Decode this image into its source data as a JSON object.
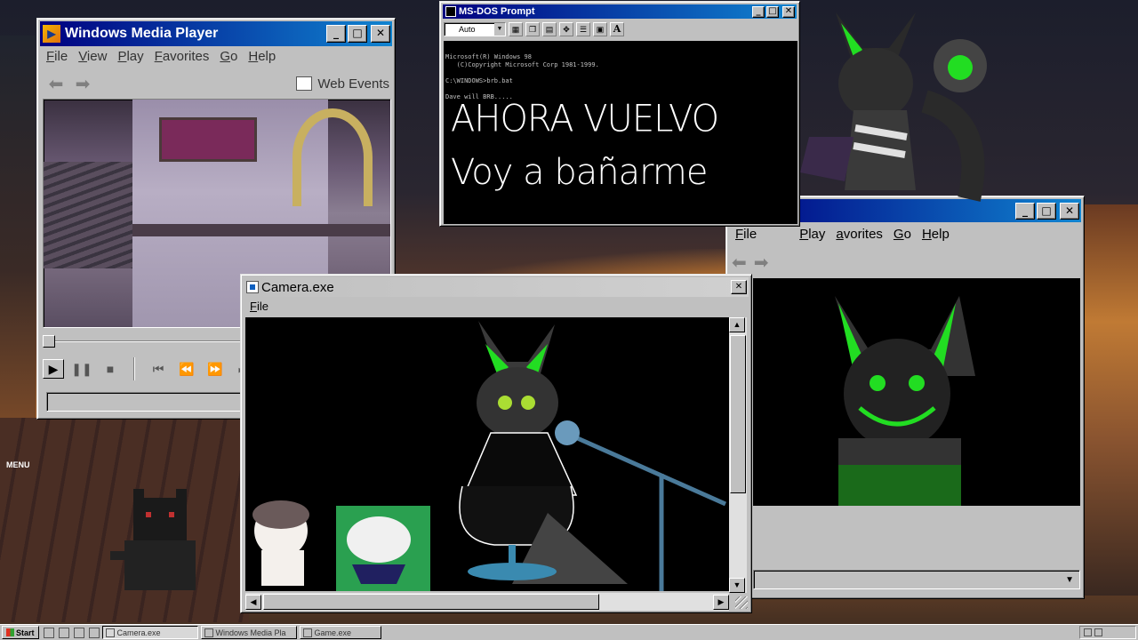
{
  "background": {
    "menu_label": "MENU"
  },
  "wmp": {
    "title": "Windows Media Player",
    "menu": [
      "File",
      "View",
      "Play",
      "Favorites",
      "Go",
      "Help"
    ],
    "web_events": "Web Events",
    "controls": [
      "play-icon",
      "pause-icon",
      "stop-icon",
      "skip-back-icon",
      "rewind-icon",
      "fast-forward-icon",
      "skip-forward-icon"
    ]
  },
  "dos": {
    "title": "MS-DOS Prompt",
    "font_size_select": "Auto",
    "console": {
      "line1": "Microsoft(R) Windows 98",
      "line2": "   (C)Copyright Microsoft Corp 1981-1999.",
      "line3": "C:\\WINDOWS>brb.bat",
      "line4": "Dave will BRB....."
    },
    "headline": "AHORA VUELVO",
    "subline": "Voy a bañarme"
  },
  "game": {
    "menu": [
      "File",
      "Play",
      "avorites",
      "Go",
      "Help"
    ]
  },
  "camera": {
    "title": "Camera.exe",
    "menu": [
      "File"
    ]
  },
  "taskbar": {
    "start": "Start",
    "tasks": [
      "Camera.exe",
      "Windows Media Pla",
      "Game.exe"
    ]
  },
  "colors": {
    "title_active_start": "#000080",
    "title_active_end": "#1084d0",
    "accent_green": "#22dd22"
  }
}
